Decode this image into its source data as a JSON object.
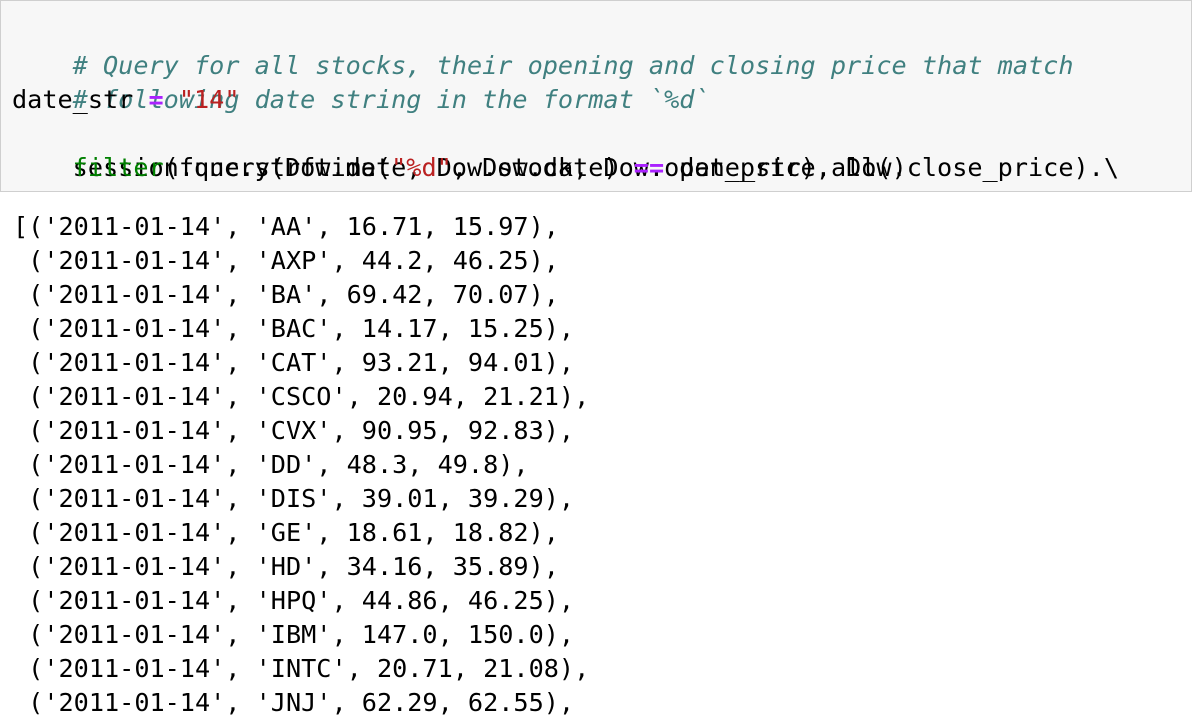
{
  "code_cell": {
    "comment_line_1": "# Query for all stocks, their opening and closing price that match",
    "comment_line_2": "# following date string in the format `%d`",
    "line_3": {
      "var": "date_str",
      "op": "=",
      "value": "\"14\""
    },
    "line_4": "session.query(Dow.date, Dow.stock, Dow.open_price, Dow.close_price).\\",
    "line_5": {
      "indent": "    ",
      "func": "filter",
      "middle": "(func.strftime(",
      "fmt": "\"%d\"",
      "args": ", Dow.date) ",
      "op": "==",
      "tail": " date_str).all()"
    }
  },
  "output": {
    "rows": [
      "[('2011-01-14', 'AA', 16.71, 15.97),",
      " ('2011-01-14', 'AXP', 44.2, 46.25),",
      " ('2011-01-14', 'BA', 69.42, 70.07),",
      " ('2011-01-14', 'BAC', 14.17, 15.25),",
      " ('2011-01-14', 'CAT', 93.21, 94.01),",
      " ('2011-01-14', 'CSCO', 20.94, 21.21),",
      " ('2011-01-14', 'CVX', 90.95, 92.83),",
      " ('2011-01-14', 'DD', 48.3, 49.8),",
      " ('2011-01-14', 'DIS', 39.01, 39.29),",
      " ('2011-01-14', 'GE', 18.61, 18.82),",
      " ('2011-01-14', 'HD', 34.16, 35.89),",
      " ('2011-01-14', 'HPQ', 44.86, 46.25),",
      " ('2011-01-14', 'IBM', 147.0, 150.0),",
      " ('2011-01-14', 'INTC', 20.71, 21.08),",
      " ('2011-01-14', 'JNJ', 62.29, 62.55),"
    ]
  },
  "colors": {
    "comment": "#408080",
    "operator": "#aa22ff",
    "string": "#ba2121",
    "builtin": "#008000",
    "cell_background": "#f7f7f7",
    "cell_border": "#cfcfcf"
  }
}
